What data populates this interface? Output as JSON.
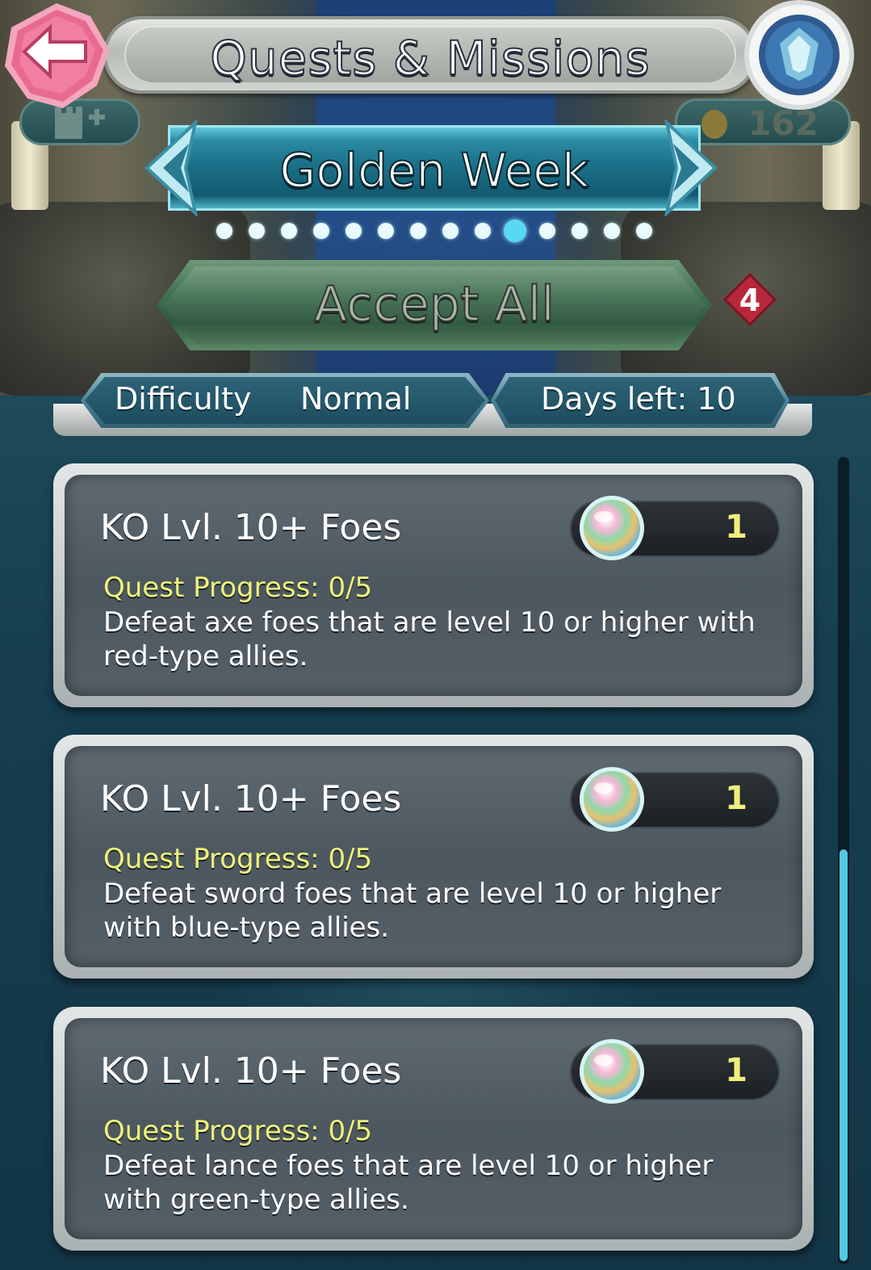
{
  "header": {
    "title": "Quests & Missions",
    "orb_count": "162"
  },
  "category": {
    "title": "Golden Week",
    "page_count": 14,
    "active_page": 10
  },
  "accept_all": {
    "label": "Accept All",
    "count": "4"
  },
  "info": {
    "difficulty_label": "Difficulty",
    "difficulty_value": "Normal",
    "days_left": "Days left: 10"
  },
  "quests": [
    {
      "title": "KO Lvl. 10+ Foes",
      "reward_qty": "1",
      "progress": "Quest Progress: 0/5",
      "description": "Defeat axe foes that are level 10 or higher with red-type allies."
    },
    {
      "title": "KO Lvl. 10+ Foes",
      "reward_qty": "1",
      "progress": "Quest Progress: 0/5",
      "description": "Defeat sword foes that are level 10 or higher with blue-type allies."
    },
    {
      "title": "KO Lvl. 10+ Foes",
      "reward_qty": "1",
      "progress": "Quest Progress: 0/5",
      "description": "Defeat lance foes that are level 10 or higher with green-type allies."
    }
  ],
  "icons": {
    "back": "back-arrow-icon",
    "badge": "my-nintendo-badge-icon",
    "orb": "orb-icon",
    "prev": "chevron-left-icon",
    "next": "chevron-right-icon"
  },
  "colors": {
    "accent_cyan": "#59d8f2",
    "progress_yellow": "#eef27a",
    "back_pink": "#e86a8e"
  }
}
